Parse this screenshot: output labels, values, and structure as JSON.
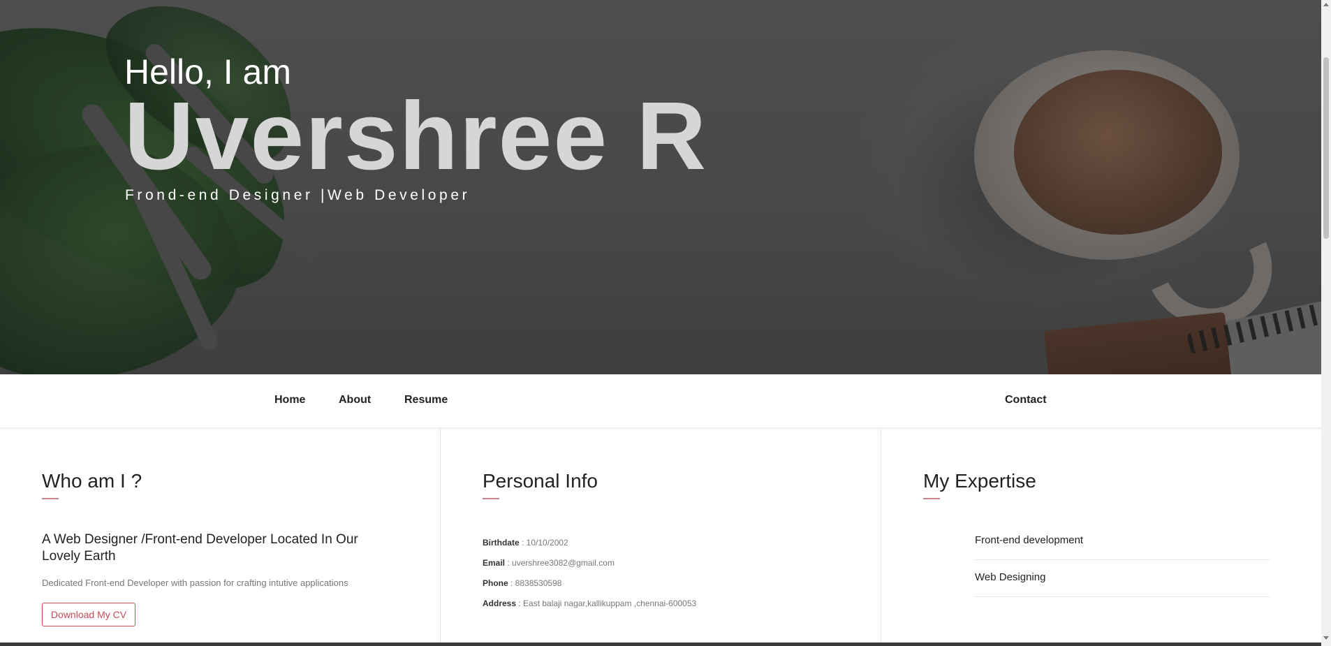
{
  "hero": {
    "greeting": "Hello, I am",
    "name": "Uvershree R",
    "role": "Frond-end Designer |Web Developer"
  },
  "nav": {
    "items": [
      {
        "label": "Home"
      },
      {
        "label": "About"
      },
      {
        "label": "Resume"
      },
      {
        "label": "Contact"
      }
    ]
  },
  "about": {
    "title": "Who am I ?",
    "tagline": "A Web Designer /Front-end Developer Located In Our Lovely Earth",
    "description": "Dedicated Front-end Developer with passion for crafting intutive applications",
    "cv_button": "Download My CV"
  },
  "personal_info": {
    "title": "Personal Info",
    "items": [
      {
        "label": "Birthdate",
        "value": " : 10/10/2002"
      },
      {
        "label": "Email",
        "value": " : uvershree3082@gmail.com"
      },
      {
        "label": "Phone",
        "value": " : 8838530598"
      },
      {
        "label": "Address",
        "value": " : East balaji nagar,kallikuppam ,chennai-600053"
      }
    ]
  },
  "expertise": {
    "title": "My Expertise",
    "items": [
      "Front-end development",
      "Web Designing"
    ]
  },
  "colors": {
    "accent": "#c84b5a",
    "underline": "#c8848c",
    "hero_overlay": "#474747"
  },
  "icons": {
    "scroll_up": "chevron-up-icon",
    "scroll_down": "chevron-down-icon"
  }
}
